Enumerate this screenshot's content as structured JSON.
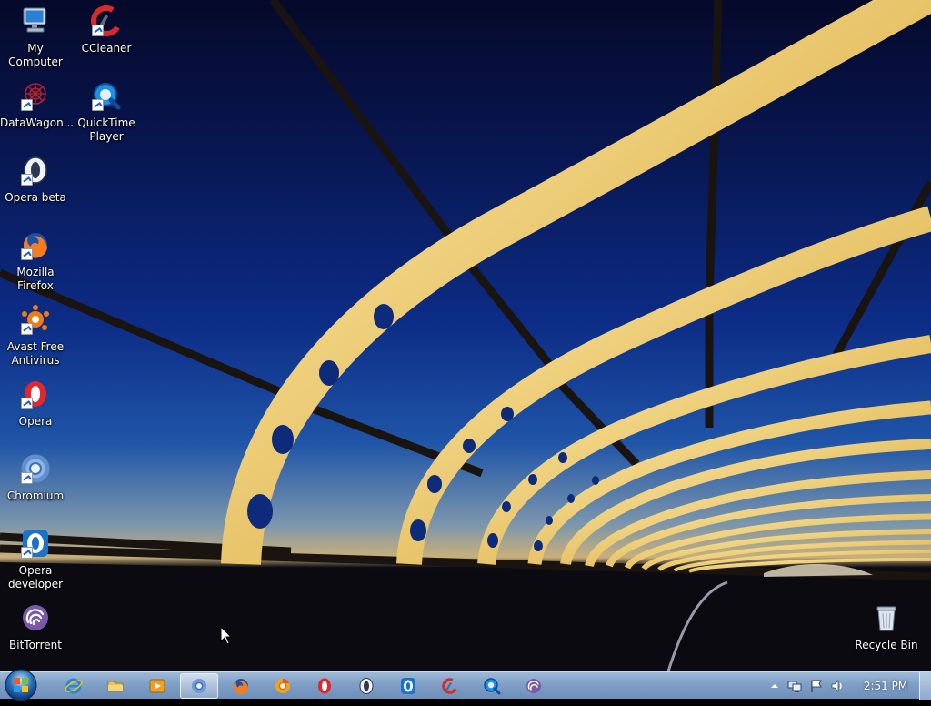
{
  "desktop": {
    "icons": [
      {
        "label": "My Computer",
        "icon": "computer-icon"
      },
      {
        "label": "CCleaner",
        "icon": "ccleaner-icon"
      },
      {
        "label": "DataWagon...",
        "icon": "datawagon-icon"
      },
      {
        "label": "QuickTime Player",
        "icon": "quicktime-icon"
      },
      {
        "label": "Opera beta",
        "icon": "opera-beta-icon"
      },
      {
        "label": "Mozilla Firefox",
        "icon": "firefox-icon"
      },
      {
        "label": "Avast Free Antivirus",
        "icon": "avast-icon"
      },
      {
        "label": "Opera",
        "icon": "opera-icon"
      },
      {
        "label": "Chromium",
        "icon": "chromium-icon"
      },
      {
        "label": "Opera developer",
        "icon": "opera-developer-icon"
      },
      {
        "label": "BitTorrent",
        "icon": "bittorrent-icon"
      },
      {
        "label": "Recycle Bin",
        "icon": "recycle-bin-icon"
      }
    ]
  },
  "taskbar": {
    "start_icon": "windows-start-icon",
    "pinned": [
      {
        "icon": "internet-explorer-icon",
        "active": false
      },
      {
        "icon": "file-explorer-icon",
        "active": false
      },
      {
        "icon": "media-player-icon",
        "active": false
      },
      {
        "icon": "chromium-icon",
        "active": true
      },
      {
        "icon": "firefox-icon",
        "active": false
      },
      {
        "icon": "chrome-canary-icon",
        "active": false
      },
      {
        "icon": "opera-icon",
        "active": false
      },
      {
        "icon": "opera-beta-icon",
        "active": false
      },
      {
        "icon": "opera-developer-icon",
        "active": false
      },
      {
        "icon": "ccleaner-icon",
        "active": false
      },
      {
        "icon": "quicktime-icon",
        "active": false
      },
      {
        "icon": "bittorrent-icon",
        "active": false
      }
    ],
    "tray_icons": [
      "show-hidden-icons-arrow",
      "network-icon",
      "action-center-flag-icon",
      "volume-icon"
    ],
    "clock": "2:51 PM"
  },
  "colors": {
    "opera_red": "#e3262b",
    "firefox_orange": "#f57c1f",
    "taskbar_blue": "#7f9fc6",
    "sky_deep": "#081650"
  }
}
